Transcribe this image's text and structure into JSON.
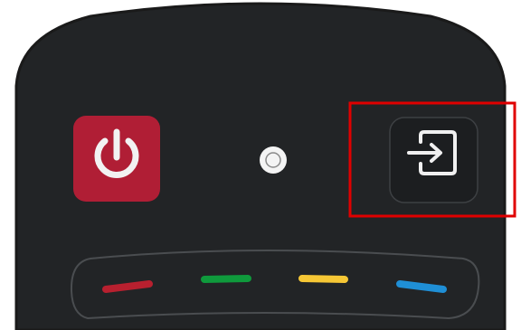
{
  "remote": {
    "body_color": "#222426",
    "outline_color": "#1a1a1a",
    "rim_color": "#4a4d50"
  },
  "buttons": {
    "power": {
      "icon": "power-icon",
      "color": "#b01e35"
    },
    "sensor": {
      "icon": "ir-sensor"
    },
    "input": {
      "icon": "input-source-icon",
      "highlighted": true
    }
  },
  "highlight": {
    "color": "#e00000"
  },
  "color_keys": [
    {
      "name": "red",
      "color": "#b8202f"
    },
    {
      "name": "green",
      "color": "#0f9a3c"
    },
    {
      "name": "yellow",
      "color": "#f6c735"
    },
    {
      "name": "blue",
      "color": "#1f8fd6"
    }
  ]
}
